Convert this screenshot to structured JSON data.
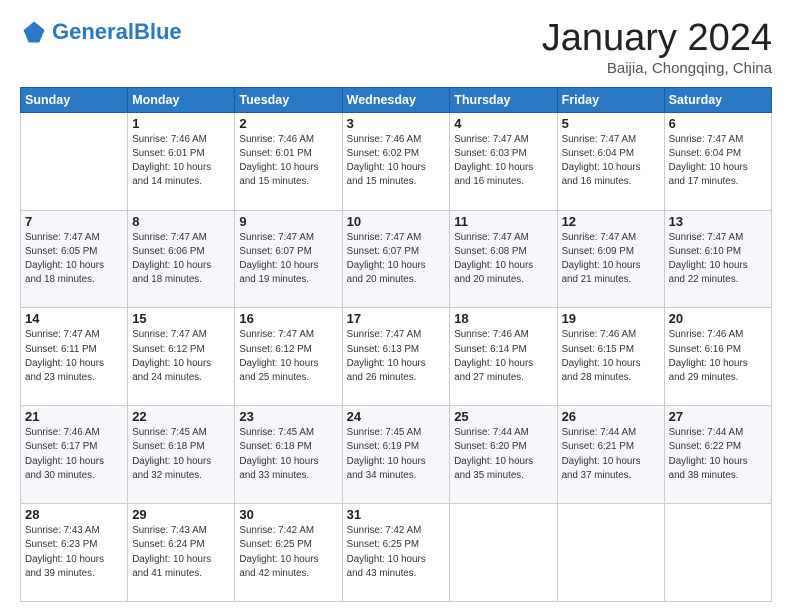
{
  "header": {
    "logo_general": "General",
    "logo_blue": "Blue",
    "month": "January 2024",
    "location": "Baijia, Chongqing, China"
  },
  "days_of_week": [
    "Sunday",
    "Monday",
    "Tuesday",
    "Wednesday",
    "Thursday",
    "Friday",
    "Saturday"
  ],
  "weeks": [
    [
      {
        "num": "",
        "info": ""
      },
      {
        "num": "1",
        "info": "Sunrise: 7:46 AM\nSunset: 6:01 PM\nDaylight: 10 hours\nand 14 minutes."
      },
      {
        "num": "2",
        "info": "Sunrise: 7:46 AM\nSunset: 6:01 PM\nDaylight: 10 hours\nand 15 minutes."
      },
      {
        "num": "3",
        "info": "Sunrise: 7:46 AM\nSunset: 6:02 PM\nDaylight: 10 hours\nand 15 minutes."
      },
      {
        "num": "4",
        "info": "Sunrise: 7:47 AM\nSunset: 6:03 PM\nDaylight: 10 hours\nand 16 minutes."
      },
      {
        "num": "5",
        "info": "Sunrise: 7:47 AM\nSunset: 6:04 PM\nDaylight: 10 hours\nand 16 minutes."
      },
      {
        "num": "6",
        "info": "Sunrise: 7:47 AM\nSunset: 6:04 PM\nDaylight: 10 hours\nand 17 minutes."
      }
    ],
    [
      {
        "num": "7",
        "info": "Sunrise: 7:47 AM\nSunset: 6:05 PM\nDaylight: 10 hours\nand 18 minutes."
      },
      {
        "num": "8",
        "info": "Sunrise: 7:47 AM\nSunset: 6:06 PM\nDaylight: 10 hours\nand 18 minutes."
      },
      {
        "num": "9",
        "info": "Sunrise: 7:47 AM\nSunset: 6:07 PM\nDaylight: 10 hours\nand 19 minutes."
      },
      {
        "num": "10",
        "info": "Sunrise: 7:47 AM\nSunset: 6:07 PM\nDaylight: 10 hours\nand 20 minutes."
      },
      {
        "num": "11",
        "info": "Sunrise: 7:47 AM\nSunset: 6:08 PM\nDaylight: 10 hours\nand 20 minutes."
      },
      {
        "num": "12",
        "info": "Sunrise: 7:47 AM\nSunset: 6:09 PM\nDaylight: 10 hours\nand 21 minutes."
      },
      {
        "num": "13",
        "info": "Sunrise: 7:47 AM\nSunset: 6:10 PM\nDaylight: 10 hours\nand 22 minutes."
      }
    ],
    [
      {
        "num": "14",
        "info": "Sunrise: 7:47 AM\nSunset: 6:11 PM\nDaylight: 10 hours\nand 23 minutes."
      },
      {
        "num": "15",
        "info": "Sunrise: 7:47 AM\nSunset: 6:12 PM\nDaylight: 10 hours\nand 24 minutes."
      },
      {
        "num": "16",
        "info": "Sunrise: 7:47 AM\nSunset: 6:12 PM\nDaylight: 10 hours\nand 25 minutes."
      },
      {
        "num": "17",
        "info": "Sunrise: 7:47 AM\nSunset: 6:13 PM\nDaylight: 10 hours\nand 26 minutes."
      },
      {
        "num": "18",
        "info": "Sunrise: 7:46 AM\nSunset: 6:14 PM\nDaylight: 10 hours\nand 27 minutes."
      },
      {
        "num": "19",
        "info": "Sunrise: 7:46 AM\nSunset: 6:15 PM\nDaylight: 10 hours\nand 28 minutes."
      },
      {
        "num": "20",
        "info": "Sunrise: 7:46 AM\nSunset: 6:16 PM\nDaylight: 10 hours\nand 29 minutes."
      }
    ],
    [
      {
        "num": "21",
        "info": "Sunrise: 7:46 AM\nSunset: 6:17 PM\nDaylight: 10 hours\nand 30 minutes."
      },
      {
        "num": "22",
        "info": "Sunrise: 7:45 AM\nSunset: 6:18 PM\nDaylight: 10 hours\nand 32 minutes."
      },
      {
        "num": "23",
        "info": "Sunrise: 7:45 AM\nSunset: 6:18 PM\nDaylight: 10 hours\nand 33 minutes."
      },
      {
        "num": "24",
        "info": "Sunrise: 7:45 AM\nSunset: 6:19 PM\nDaylight: 10 hours\nand 34 minutes."
      },
      {
        "num": "25",
        "info": "Sunrise: 7:44 AM\nSunset: 6:20 PM\nDaylight: 10 hours\nand 35 minutes."
      },
      {
        "num": "26",
        "info": "Sunrise: 7:44 AM\nSunset: 6:21 PM\nDaylight: 10 hours\nand 37 minutes."
      },
      {
        "num": "27",
        "info": "Sunrise: 7:44 AM\nSunset: 6:22 PM\nDaylight: 10 hours\nand 38 minutes."
      }
    ],
    [
      {
        "num": "28",
        "info": "Sunrise: 7:43 AM\nSunset: 6:23 PM\nDaylight: 10 hours\nand 39 minutes."
      },
      {
        "num": "29",
        "info": "Sunrise: 7:43 AM\nSunset: 6:24 PM\nDaylight: 10 hours\nand 41 minutes."
      },
      {
        "num": "30",
        "info": "Sunrise: 7:42 AM\nSunset: 6:25 PM\nDaylight: 10 hours\nand 42 minutes."
      },
      {
        "num": "31",
        "info": "Sunrise: 7:42 AM\nSunset: 6:25 PM\nDaylight: 10 hours\nand 43 minutes."
      },
      {
        "num": "",
        "info": ""
      },
      {
        "num": "",
        "info": ""
      },
      {
        "num": "",
        "info": ""
      }
    ]
  ]
}
